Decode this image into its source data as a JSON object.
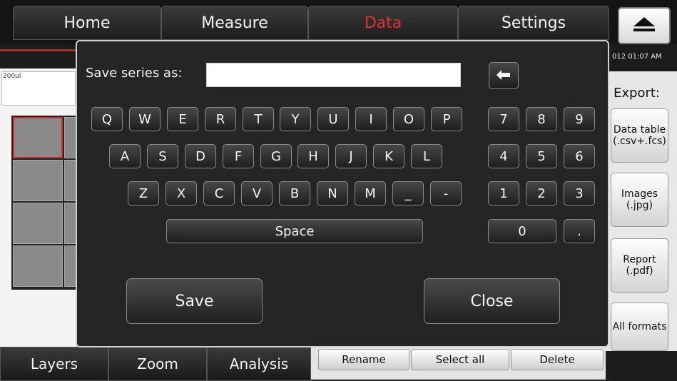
{
  "top_tabs": [
    {
      "label": "Home"
    },
    {
      "label": "Measure"
    },
    {
      "label": "Data",
      "active": true
    },
    {
      "label": "Settings"
    }
  ],
  "eject_icon": "eject-icon",
  "datetime": "012 01:07 AM",
  "sample": {
    "label": "200ul"
  },
  "export": {
    "title": "Export:",
    "buttons": [
      {
        "label": "Data table (.csv+.fcs)"
      },
      {
        "label": "Images (.jpg)"
      },
      {
        "label": "Report (.pdf)"
      },
      {
        "label": "All formats"
      }
    ]
  },
  "bottom_tabs": [
    {
      "label": "Layers"
    },
    {
      "label": "Zoom"
    },
    {
      "label": "Analysis"
    }
  ],
  "bottom_actions": [
    {
      "label": "Rename"
    },
    {
      "label": "Select all"
    },
    {
      "label": "Delete"
    }
  ],
  "dialog": {
    "label": "Save series as:",
    "input_value": "",
    "backspace_icon": "backspace-arrow-icon",
    "keys": {
      "row1": [
        "Q",
        "W",
        "E",
        "R",
        "T",
        "Y",
        "U",
        "I",
        "O",
        "P"
      ],
      "row2": [
        "A",
        "S",
        "D",
        "F",
        "G",
        "H",
        "J",
        "K",
        "L"
      ],
      "row3": [
        "Z",
        "X",
        "C",
        "V",
        "B",
        "N",
        "M",
        "_",
        "-"
      ],
      "num1": [
        "7",
        "8",
        "9"
      ],
      "num2": [
        "4",
        "5",
        "6"
      ],
      "num3": [
        "1",
        "2",
        "3"
      ],
      "num4": [
        "0",
        "."
      ]
    },
    "space_label": "Space",
    "save_label": "Save",
    "close_label": "Close"
  },
  "colors": {
    "active_tab": "#e23030",
    "selection": "#d42a2a"
  }
}
